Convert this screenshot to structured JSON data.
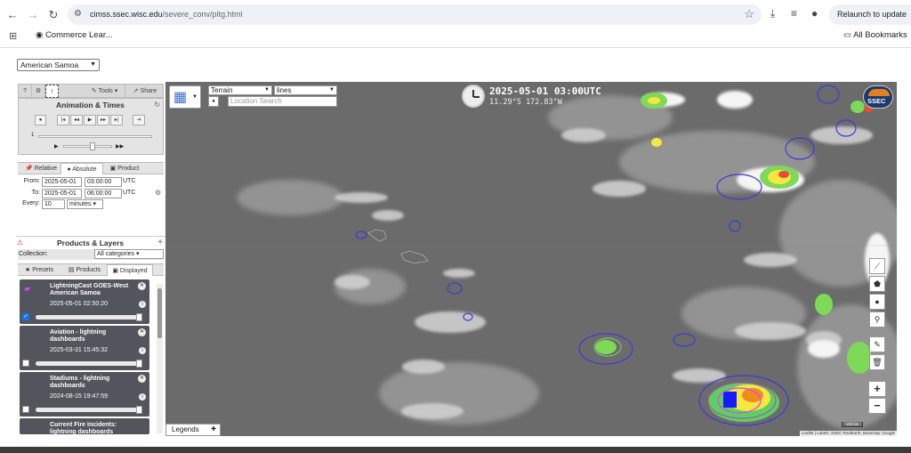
{
  "browser": {
    "url_host": "cimss.ssec.wisc.edu",
    "url_path": "/severe_conv/pltg.html",
    "relaunch_label": "Relaunch to update",
    "bookmark_1": "Commerce Lear...",
    "all_bookmarks": "All Bookmarks"
  },
  "page": {
    "region_select": "American Samoa"
  },
  "panel": {
    "tabs": {
      "help": "?",
      "gear": "⚙",
      "info": "!",
      "tools": "Tools",
      "share": "Share"
    },
    "animation_title": "Animation & Times",
    "speed_value": "1",
    "time_tabs": [
      "Relative",
      "Absolute",
      "Product"
    ],
    "from_label": "From:",
    "from_date": "2025-05-01",
    "from_time": "03:00:00",
    "from_tz": "UTC",
    "to_label": "To:",
    "to_date": "2025-05-01",
    "to_time": "06:00:00",
    "to_tz": "UTC",
    "every_label": "Every:",
    "every_value": "10",
    "every_unit": "minutes",
    "products_title": "Products & Layers",
    "collection_label": "Collection:",
    "collection_value": "All categories",
    "lists_tabs": [
      "Presets",
      "Products",
      "Displayed"
    ],
    "layers": [
      {
        "name": "LightningCast GOES-West American Samoa",
        "time": "2025-05-01 02:50:20",
        "checked": true
      },
      {
        "name": "Aviation - lightning dashboards",
        "time": "2025-03-31 15:45:32",
        "checked": false
      },
      {
        "name": "Stadiums - lightning dashboards",
        "time": "2024-08-15 19:47:59",
        "checked": false
      },
      {
        "name": "Current Fire Incidents: lightning dashboards",
        "time": "",
        "checked": false
      }
    ]
  },
  "map": {
    "basemap_select": "Terrain",
    "overlay_select": "lines",
    "search_placeholder": "Location Search",
    "datetime": "2025-05-01 03:00UTC",
    "coords": "11.29°S 172.83°W",
    "legends_label": "Legends",
    "attribution": "Leaflet | Labels: SSEC RealEarth, Basemap: Google",
    "scale_label": "100 km",
    "logo": "SSEC"
  }
}
